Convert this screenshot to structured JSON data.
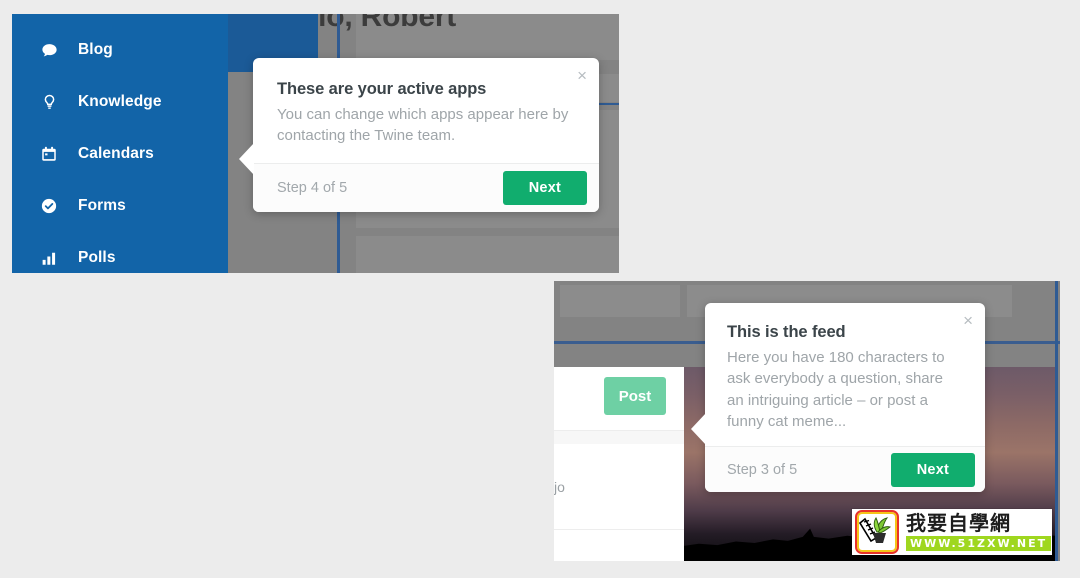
{
  "page": {
    "background_color": "#ececec"
  },
  "panel_one": {
    "greeting": "Hello, Robert",
    "sidebar": {
      "background_color": "#1264a8",
      "items": [
        {
          "label": "Blog",
          "icon": "speech-bubble-icon"
        },
        {
          "label": "Knowledge",
          "icon": "lightbulb-icon"
        },
        {
          "label": "Calendars",
          "icon": "calendar-icon"
        },
        {
          "label": "Forms",
          "icon": "check-circle-icon"
        },
        {
          "label": "Polls",
          "icon": "bar-chart-icon"
        }
      ]
    },
    "tooltip": {
      "title": "These are your active apps",
      "text": "You can change which apps appear here by contacting the Twine team.",
      "step": "Step 4 of 5",
      "next_label": "Next",
      "close_icon": "×",
      "accent_color": "#11ad6e"
    }
  },
  "panel_two": {
    "post_button_label": "Post",
    "post_button_color": "#6ed0a4",
    "feed_snippet": "jo",
    "tooltip": {
      "title": "This is the feed",
      "text": "Here you have 180 characters to ask everybody a question, share an intriguing article – or post a funny cat meme...",
      "step": "Step 3 of 5",
      "next_label": "Next",
      "close_icon": "×",
      "accent_color": "#11ad6e"
    }
  },
  "watermark": {
    "brand_cn": "我要自學網",
    "url": "WWW.51ZXW.NET",
    "logo_icon": "plant-in-pot-icon",
    "url_background": "#9fd71f",
    "border_color": "#e8322a"
  }
}
